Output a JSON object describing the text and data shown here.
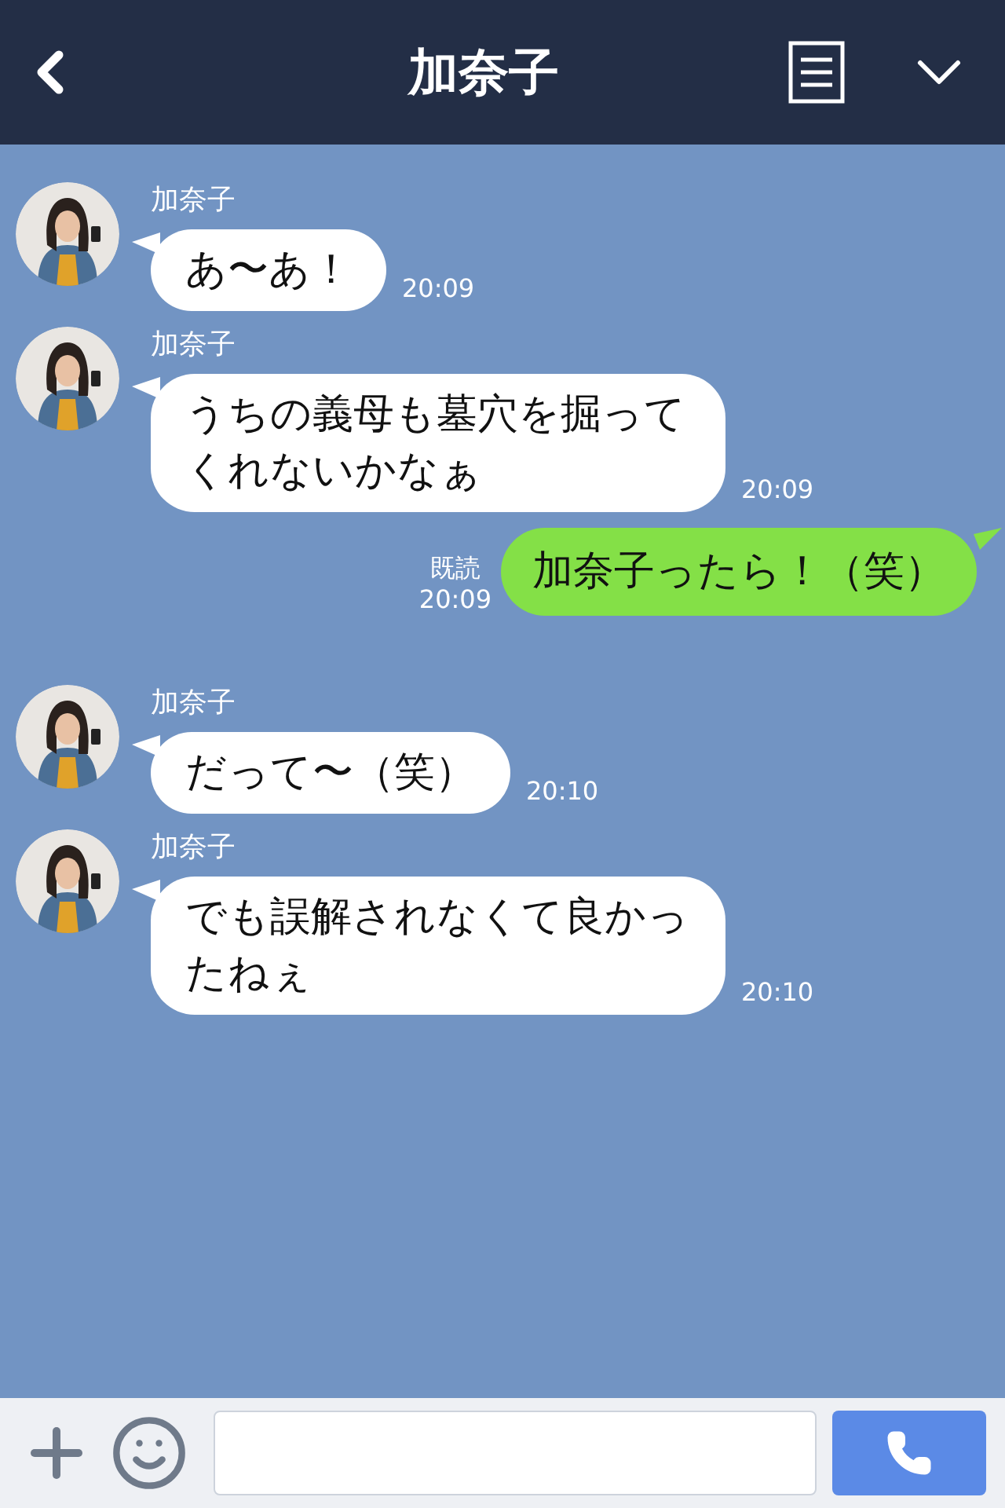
{
  "header": {
    "title": "加奈子"
  },
  "messages": [
    {
      "kind": "received",
      "sender": "加奈子",
      "text": "あ〜あ！",
      "time": "20:09"
    },
    {
      "kind": "received",
      "sender": "加奈子",
      "text": "うちの義母も墓穴を掘ってくれないかなぁ",
      "time": "20:09"
    },
    {
      "kind": "sent",
      "read": "既読",
      "text": "加奈子ったら！（笑）",
      "time": "20:09"
    },
    {
      "kind": "received",
      "sender": "加奈子",
      "text": "だって〜（笑）",
      "time": "20:10"
    },
    {
      "kind": "received",
      "sender": "加奈子",
      "text": "でも誤解されなくて良かったねぇ",
      "time": "20:10"
    }
  ]
}
